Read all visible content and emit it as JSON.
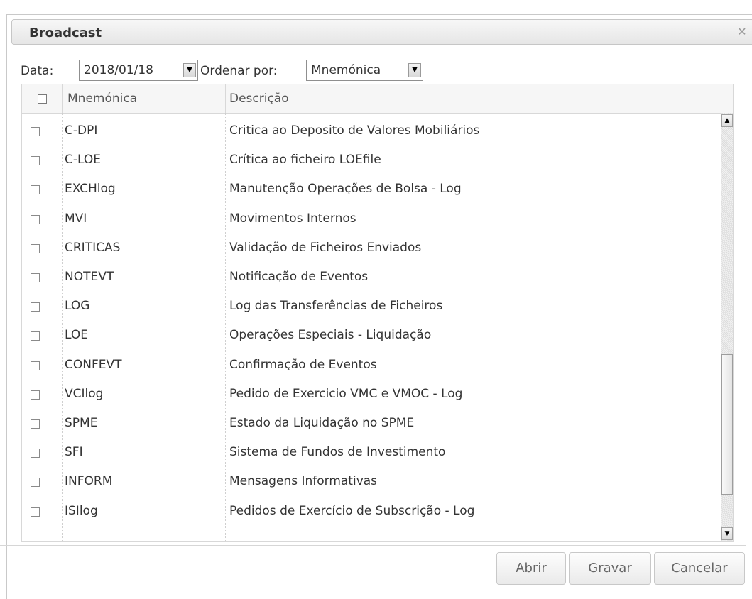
{
  "dialog": {
    "title": "Broadcast",
    "close_glyph": "✕"
  },
  "filters": {
    "date_label": "Data:",
    "date_value": "2018/01/18",
    "order_label": "Ordenar por:",
    "order_value": "Mnemónica"
  },
  "table": {
    "headers": {
      "mnemonic": "Mnemónica",
      "description": "Descrição"
    },
    "rows": [
      {
        "mnemonic": "C-DPI",
        "description": "Critica ao Deposito de Valores Mobiliários"
      },
      {
        "mnemonic": "C-LOE",
        "description": "Crítica ao ficheiro LOEfile"
      },
      {
        "mnemonic": "EXCHlog",
        "description": "Manutenção Operações de Bolsa - Log"
      },
      {
        "mnemonic": "MVI",
        "description": "Movimentos Internos"
      },
      {
        "mnemonic": "CRITICAS",
        "description": "Validação de Ficheiros Enviados"
      },
      {
        "mnemonic": "NOTEVT",
        "description": "Notificação de Eventos"
      },
      {
        "mnemonic": "LOG",
        "description": "Log das Transferências de Ficheiros"
      },
      {
        "mnemonic": "LOE",
        "description": "Operações Especiais - Liquidação"
      },
      {
        "mnemonic": "CONFEVT",
        "description": "Confirmação de Eventos"
      },
      {
        "mnemonic": "VCIlog",
        "description": "Pedido de Exercicio VMC e VMOC - Log"
      },
      {
        "mnemonic": "SPME",
        "description": "Estado da Liquidação no SPME"
      },
      {
        "mnemonic": "SFI",
        "description": "Sistema de Fundos de Investimento"
      },
      {
        "mnemonic": "INFORM",
        "description": "Mensagens Informativas"
      },
      {
        "mnemonic": "ISIlog",
        "description": "Pedidos de Exercício de Subscrição - Log"
      }
    ]
  },
  "buttons": {
    "open": "Abrir",
    "save": "Gravar",
    "cancel": "Cancelar"
  },
  "colors": {
    "accent": "#333333",
    "titlebar": "#e9e9e9"
  }
}
